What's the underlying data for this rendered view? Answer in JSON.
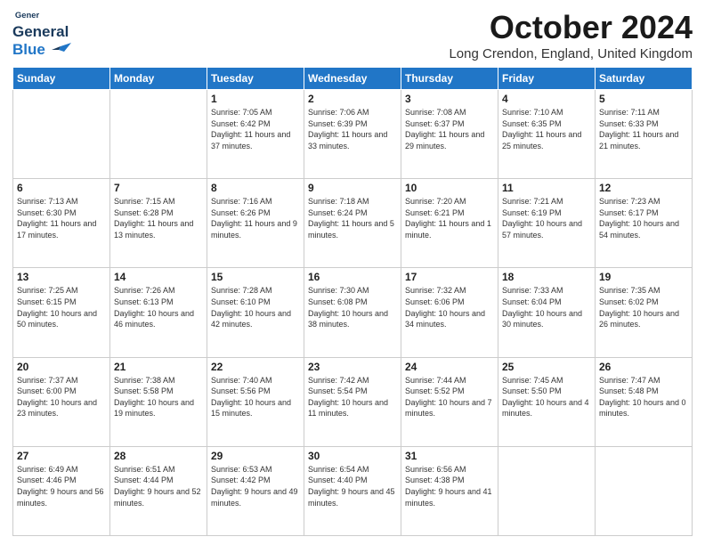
{
  "header": {
    "logo_general": "General",
    "logo_blue": "Blue",
    "month_title": "October 2024",
    "location": "Long Crendon, England, United Kingdom"
  },
  "days_of_week": [
    "Sunday",
    "Monday",
    "Tuesday",
    "Wednesday",
    "Thursday",
    "Friday",
    "Saturday"
  ],
  "weeks": [
    [
      {
        "day": "",
        "info": ""
      },
      {
        "day": "",
        "info": ""
      },
      {
        "day": "1",
        "info": "Sunrise: 7:05 AM\nSunset: 6:42 PM\nDaylight: 11 hours and 37 minutes."
      },
      {
        "day": "2",
        "info": "Sunrise: 7:06 AM\nSunset: 6:39 PM\nDaylight: 11 hours and 33 minutes."
      },
      {
        "day": "3",
        "info": "Sunrise: 7:08 AM\nSunset: 6:37 PM\nDaylight: 11 hours and 29 minutes."
      },
      {
        "day": "4",
        "info": "Sunrise: 7:10 AM\nSunset: 6:35 PM\nDaylight: 11 hours and 25 minutes."
      },
      {
        "day": "5",
        "info": "Sunrise: 7:11 AM\nSunset: 6:33 PM\nDaylight: 11 hours and 21 minutes."
      }
    ],
    [
      {
        "day": "6",
        "info": "Sunrise: 7:13 AM\nSunset: 6:30 PM\nDaylight: 11 hours and 17 minutes."
      },
      {
        "day": "7",
        "info": "Sunrise: 7:15 AM\nSunset: 6:28 PM\nDaylight: 11 hours and 13 minutes."
      },
      {
        "day": "8",
        "info": "Sunrise: 7:16 AM\nSunset: 6:26 PM\nDaylight: 11 hours and 9 minutes."
      },
      {
        "day": "9",
        "info": "Sunrise: 7:18 AM\nSunset: 6:24 PM\nDaylight: 11 hours and 5 minutes."
      },
      {
        "day": "10",
        "info": "Sunrise: 7:20 AM\nSunset: 6:21 PM\nDaylight: 11 hours and 1 minute."
      },
      {
        "day": "11",
        "info": "Sunrise: 7:21 AM\nSunset: 6:19 PM\nDaylight: 10 hours and 57 minutes."
      },
      {
        "day": "12",
        "info": "Sunrise: 7:23 AM\nSunset: 6:17 PM\nDaylight: 10 hours and 54 minutes."
      }
    ],
    [
      {
        "day": "13",
        "info": "Sunrise: 7:25 AM\nSunset: 6:15 PM\nDaylight: 10 hours and 50 minutes."
      },
      {
        "day": "14",
        "info": "Sunrise: 7:26 AM\nSunset: 6:13 PM\nDaylight: 10 hours and 46 minutes."
      },
      {
        "day": "15",
        "info": "Sunrise: 7:28 AM\nSunset: 6:10 PM\nDaylight: 10 hours and 42 minutes."
      },
      {
        "day": "16",
        "info": "Sunrise: 7:30 AM\nSunset: 6:08 PM\nDaylight: 10 hours and 38 minutes."
      },
      {
        "day": "17",
        "info": "Sunrise: 7:32 AM\nSunset: 6:06 PM\nDaylight: 10 hours and 34 minutes."
      },
      {
        "day": "18",
        "info": "Sunrise: 7:33 AM\nSunset: 6:04 PM\nDaylight: 10 hours and 30 minutes."
      },
      {
        "day": "19",
        "info": "Sunrise: 7:35 AM\nSunset: 6:02 PM\nDaylight: 10 hours and 26 minutes."
      }
    ],
    [
      {
        "day": "20",
        "info": "Sunrise: 7:37 AM\nSunset: 6:00 PM\nDaylight: 10 hours and 23 minutes."
      },
      {
        "day": "21",
        "info": "Sunrise: 7:38 AM\nSunset: 5:58 PM\nDaylight: 10 hours and 19 minutes."
      },
      {
        "day": "22",
        "info": "Sunrise: 7:40 AM\nSunset: 5:56 PM\nDaylight: 10 hours and 15 minutes."
      },
      {
        "day": "23",
        "info": "Sunrise: 7:42 AM\nSunset: 5:54 PM\nDaylight: 10 hours and 11 minutes."
      },
      {
        "day": "24",
        "info": "Sunrise: 7:44 AM\nSunset: 5:52 PM\nDaylight: 10 hours and 7 minutes."
      },
      {
        "day": "25",
        "info": "Sunrise: 7:45 AM\nSunset: 5:50 PM\nDaylight: 10 hours and 4 minutes."
      },
      {
        "day": "26",
        "info": "Sunrise: 7:47 AM\nSunset: 5:48 PM\nDaylight: 10 hours and 0 minutes."
      }
    ],
    [
      {
        "day": "27",
        "info": "Sunrise: 6:49 AM\nSunset: 4:46 PM\nDaylight: 9 hours and 56 minutes."
      },
      {
        "day": "28",
        "info": "Sunrise: 6:51 AM\nSunset: 4:44 PM\nDaylight: 9 hours and 52 minutes."
      },
      {
        "day": "29",
        "info": "Sunrise: 6:53 AM\nSunset: 4:42 PM\nDaylight: 9 hours and 49 minutes."
      },
      {
        "day": "30",
        "info": "Sunrise: 6:54 AM\nSunset: 4:40 PM\nDaylight: 9 hours and 45 minutes."
      },
      {
        "day": "31",
        "info": "Sunrise: 6:56 AM\nSunset: 4:38 PM\nDaylight: 9 hours and 41 minutes."
      },
      {
        "day": "",
        "info": ""
      },
      {
        "day": "",
        "info": ""
      }
    ]
  ]
}
